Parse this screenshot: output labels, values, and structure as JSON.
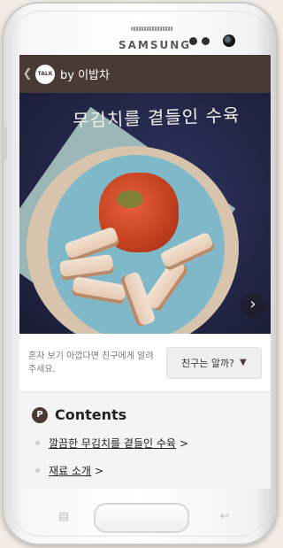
{
  "device": {
    "brand": "SAMSUNG"
  },
  "app_bar": {
    "back_icon": "chevron-left-icon",
    "talk_badge": "TALK",
    "by_label": "by 이밥차"
  },
  "hero": {
    "title": "무김치를 곁들인 수육",
    "next_icon": "chevron-right-icon"
  },
  "share": {
    "message": "혼자 보기 아깝다면 친구에게 알려주세요.",
    "button_label": "친구는 알까?",
    "button_icon": "▼"
  },
  "contents": {
    "icon_letter": "P",
    "title": "Contents",
    "items": [
      {
        "label": "깔끔한 무김치를 곁들인 수육",
        "arrow": ">"
      },
      {
        "label": "재료 소개",
        "arrow": ">"
      }
    ]
  }
}
